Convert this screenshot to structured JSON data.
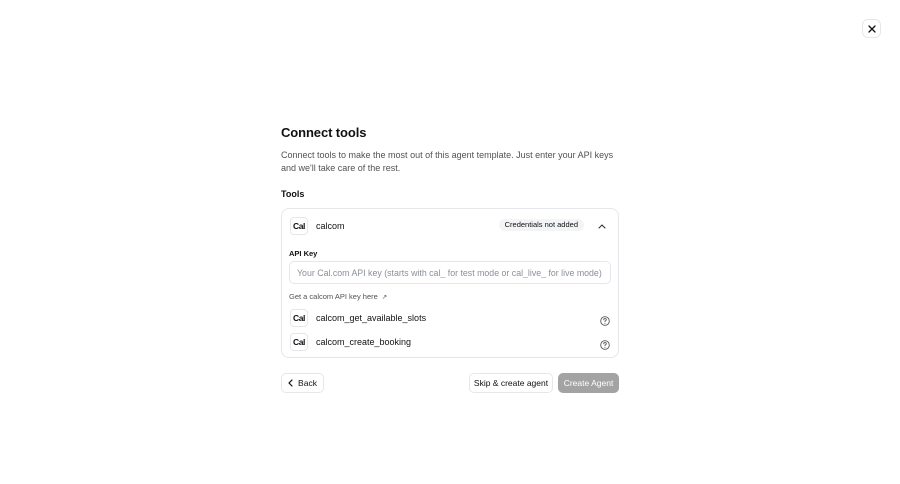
{
  "dialog": {
    "title": "Connect tools",
    "description": "Connect tools to make the most out of this agent template. Just enter your API keys and we'll take care of the rest.",
    "tools_label": "Tools"
  },
  "tool": {
    "logo_text": "Cal",
    "name": "calcom",
    "status_badge": "Credentials not added",
    "api_key_label": "API Key",
    "api_key_value": "",
    "api_key_placeholder": "Your Cal.com API key (starts with cal_ for test mode or cal_live_ for live mode)",
    "get_key_link": "Get a calcom API key here",
    "link_arrow": "↗",
    "sub_tools": [
      {
        "logo_text": "Cal",
        "name": "calcom_get_available_slots"
      },
      {
        "logo_text": "Cal",
        "name": "calcom_create_booking"
      }
    ]
  },
  "actions": {
    "back_label": "Back",
    "skip_label": "Skip & create agent",
    "create_label": "Create Agent"
  },
  "colors": {
    "create_button_bg": "#a3a3a3",
    "border": "#e5e7eb",
    "badge_bg": "#f3f4f6",
    "muted_text": "#525252"
  },
  "icons": {
    "close": "close-icon",
    "chevron": "chevron-up-icon",
    "help": "help-circle-icon",
    "back": "chevron-left-icon",
    "link": "arrow-up-right-icon"
  }
}
